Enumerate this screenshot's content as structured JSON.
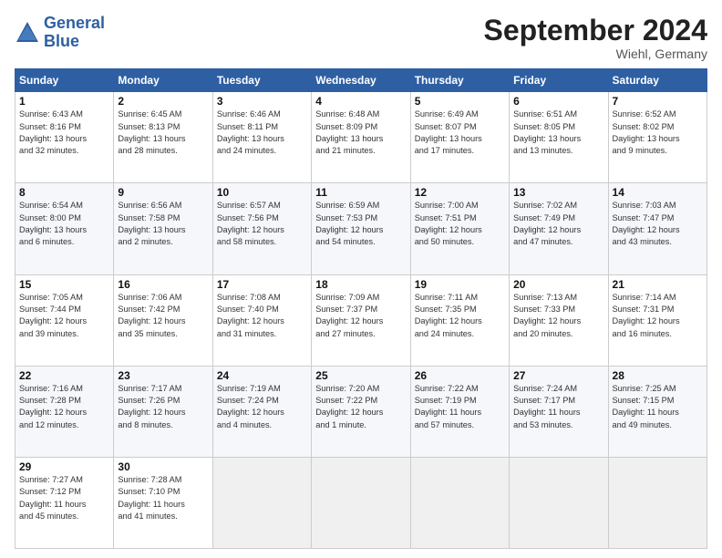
{
  "logo": {
    "line1": "General",
    "line2": "Blue"
  },
  "title": "September 2024",
  "location": "Wiehl, Germany",
  "days_header": [
    "Sunday",
    "Monday",
    "Tuesday",
    "Wednesday",
    "Thursday",
    "Friday",
    "Saturday"
  ],
  "weeks": [
    [
      {
        "day": "1",
        "info": "Sunrise: 6:43 AM\nSunset: 8:16 PM\nDaylight: 13 hours\nand 32 minutes."
      },
      {
        "day": "2",
        "info": "Sunrise: 6:45 AM\nSunset: 8:13 PM\nDaylight: 13 hours\nand 28 minutes."
      },
      {
        "day": "3",
        "info": "Sunrise: 6:46 AM\nSunset: 8:11 PM\nDaylight: 13 hours\nand 24 minutes."
      },
      {
        "day": "4",
        "info": "Sunrise: 6:48 AM\nSunset: 8:09 PM\nDaylight: 13 hours\nand 21 minutes."
      },
      {
        "day": "5",
        "info": "Sunrise: 6:49 AM\nSunset: 8:07 PM\nDaylight: 13 hours\nand 17 minutes."
      },
      {
        "day": "6",
        "info": "Sunrise: 6:51 AM\nSunset: 8:05 PM\nDaylight: 13 hours\nand 13 minutes."
      },
      {
        "day": "7",
        "info": "Sunrise: 6:52 AM\nSunset: 8:02 PM\nDaylight: 13 hours\nand 9 minutes."
      }
    ],
    [
      {
        "day": "8",
        "info": "Sunrise: 6:54 AM\nSunset: 8:00 PM\nDaylight: 13 hours\nand 6 minutes."
      },
      {
        "day": "9",
        "info": "Sunrise: 6:56 AM\nSunset: 7:58 PM\nDaylight: 13 hours\nand 2 minutes."
      },
      {
        "day": "10",
        "info": "Sunrise: 6:57 AM\nSunset: 7:56 PM\nDaylight: 12 hours\nand 58 minutes."
      },
      {
        "day": "11",
        "info": "Sunrise: 6:59 AM\nSunset: 7:53 PM\nDaylight: 12 hours\nand 54 minutes."
      },
      {
        "day": "12",
        "info": "Sunrise: 7:00 AM\nSunset: 7:51 PM\nDaylight: 12 hours\nand 50 minutes."
      },
      {
        "day": "13",
        "info": "Sunrise: 7:02 AM\nSunset: 7:49 PM\nDaylight: 12 hours\nand 47 minutes."
      },
      {
        "day": "14",
        "info": "Sunrise: 7:03 AM\nSunset: 7:47 PM\nDaylight: 12 hours\nand 43 minutes."
      }
    ],
    [
      {
        "day": "15",
        "info": "Sunrise: 7:05 AM\nSunset: 7:44 PM\nDaylight: 12 hours\nand 39 minutes."
      },
      {
        "day": "16",
        "info": "Sunrise: 7:06 AM\nSunset: 7:42 PM\nDaylight: 12 hours\nand 35 minutes."
      },
      {
        "day": "17",
        "info": "Sunrise: 7:08 AM\nSunset: 7:40 PM\nDaylight: 12 hours\nand 31 minutes."
      },
      {
        "day": "18",
        "info": "Sunrise: 7:09 AM\nSunset: 7:37 PM\nDaylight: 12 hours\nand 27 minutes."
      },
      {
        "day": "19",
        "info": "Sunrise: 7:11 AM\nSunset: 7:35 PM\nDaylight: 12 hours\nand 24 minutes."
      },
      {
        "day": "20",
        "info": "Sunrise: 7:13 AM\nSunset: 7:33 PM\nDaylight: 12 hours\nand 20 minutes."
      },
      {
        "day": "21",
        "info": "Sunrise: 7:14 AM\nSunset: 7:31 PM\nDaylight: 12 hours\nand 16 minutes."
      }
    ],
    [
      {
        "day": "22",
        "info": "Sunrise: 7:16 AM\nSunset: 7:28 PM\nDaylight: 12 hours\nand 12 minutes."
      },
      {
        "day": "23",
        "info": "Sunrise: 7:17 AM\nSunset: 7:26 PM\nDaylight: 12 hours\nand 8 minutes."
      },
      {
        "day": "24",
        "info": "Sunrise: 7:19 AM\nSunset: 7:24 PM\nDaylight: 12 hours\nand 4 minutes."
      },
      {
        "day": "25",
        "info": "Sunrise: 7:20 AM\nSunset: 7:22 PM\nDaylight: 12 hours\nand 1 minute."
      },
      {
        "day": "26",
        "info": "Sunrise: 7:22 AM\nSunset: 7:19 PM\nDaylight: 11 hours\nand 57 minutes."
      },
      {
        "day": "27",
        "info": "Sunrise: 7:24 AM\nSunset: 7:17 PM\nDaylight: 11 hours\nand 53 minutes."
      },
      {
        "day": "28",
        "info": "Sunrise: 7:25 AM\nSunset: 7:15 PM\nDaylight: 11 hours\nand 49 minutes."
      }
    ],
    [
      {
        "day": "29",
        "info": "Sunrise: 7:27 AM\nSunset: 7:12 PM\nDaylight: 11 hours\nand 45 minutes."
      },
      {
        "day": "30",
        "info": "Sunrise: 7:28 AM\nSunset: 7:10 PM\nDaylight: 11 hours\nand 41 minutes."
      },
      null,
      null,
      null,
      null,
      null
    ]
  ]
}
